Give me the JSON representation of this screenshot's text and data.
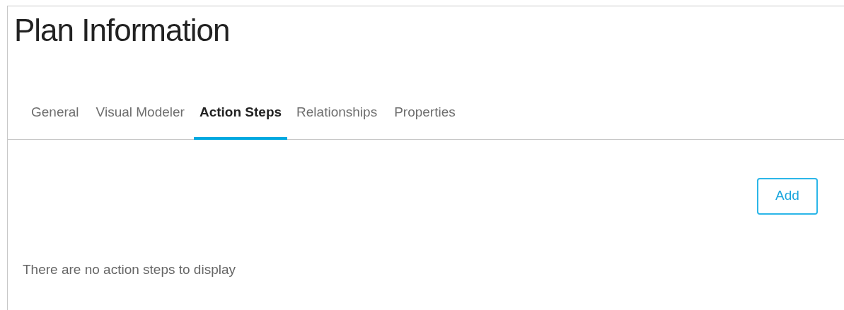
{
  "page": {
    "title": "Plan Information"
  },
  "tabs": [
    {
      "label": "General",
      "selected": false
    },
    {
      "label": "Visual Modeler",
      "selected": false
    },
    {
      "label": "Action Steps",
      "selected": true
    },
    {
      "label": "Relationships",
      "selected": false
    },
    {
      "label": "Properties",
      "selected": false
    }
  ],
  "toolbar": {
    "add_button": "Add"
  },
  "empty_message": "There are no action steps to display"
}
